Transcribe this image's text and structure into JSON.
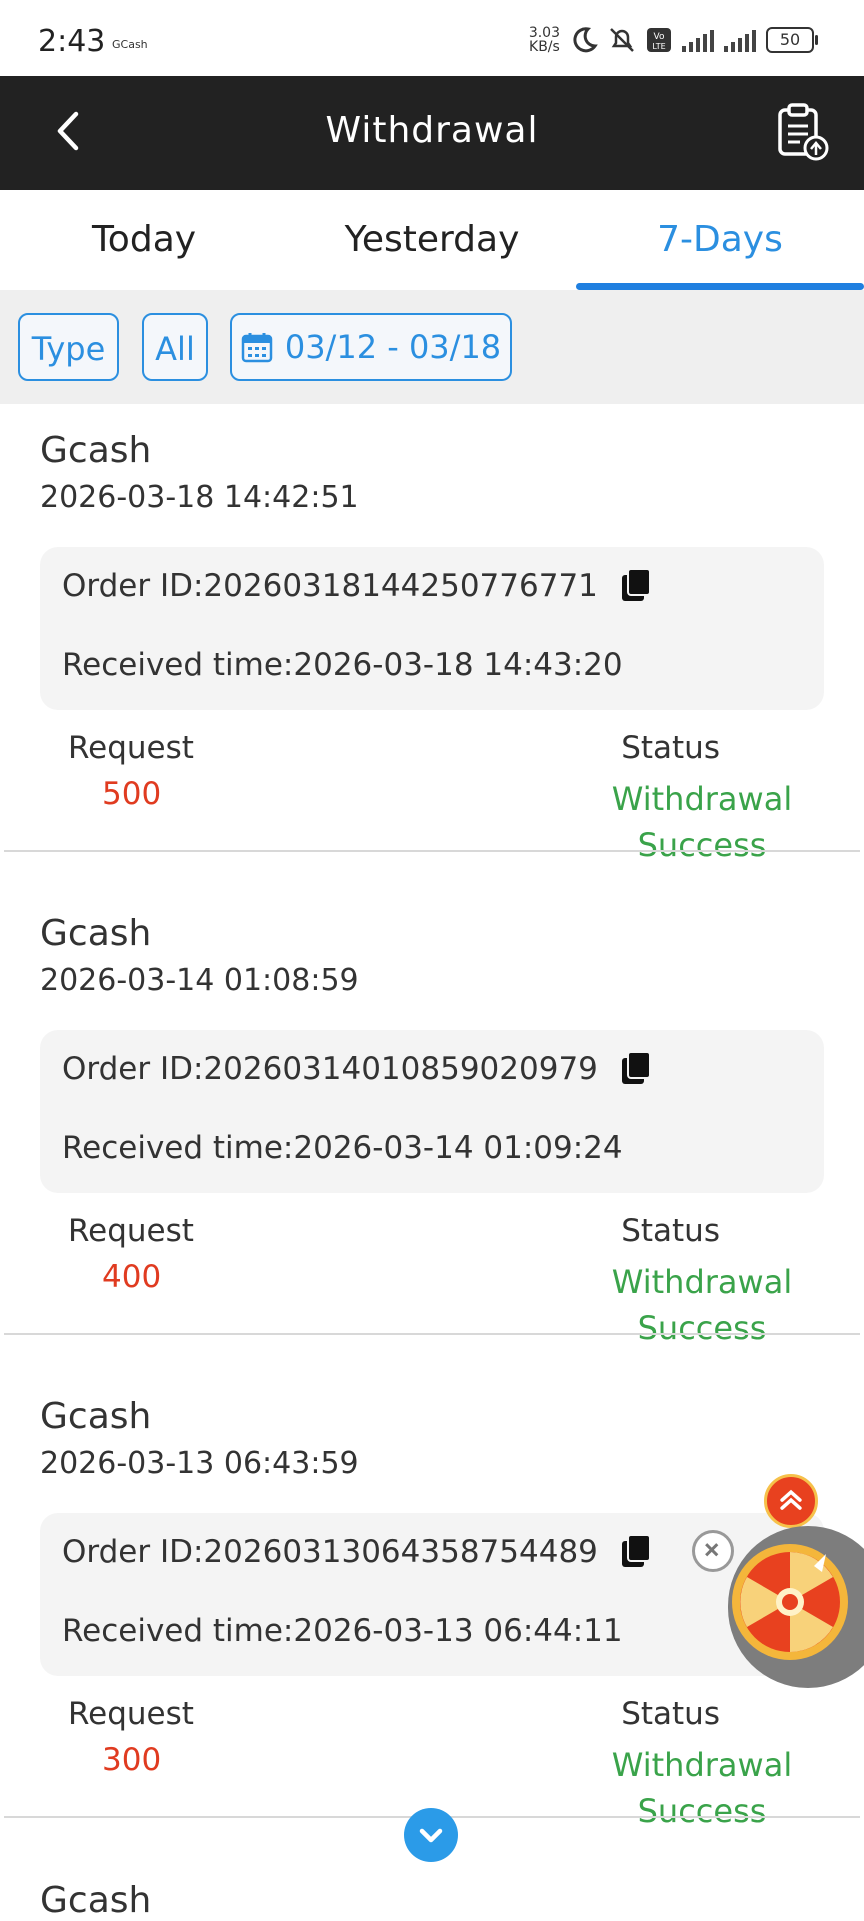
{
  "status_bar": {
    "time": "2:43",
    "app_label": "GCash",
    "net_speed": "3.03",
    "net_unit": "KB/s",
    "network_type": "4G",
    "volte": "Vo LTE",
    "battery": "50"
  },
  "header": {
    "title": "Withdrawal",
    "back_icon": "chevron-left-icon",
    "record_icon": "clipboard-upload-icon"
  },
  "tabs": [
    {
      "label": "Today",
      "active": false
    },
    {
      "label": "Yesterday",
      "active": false
    },
    {
      "label": "7-Days",
      "active": true
    }
  ],
  "filters": {
    "type_label": "Type",
    "all_label": "All",
    "date_range": "03/12 - 03/18"
  },
  "labels": {
    "order_id_prefix": "Order ID:",
    "received_prefix": "Received time:",
    "request": "Request",
    "status": "Status"
  },
  "records": [
    {
      "method": "Gcash",
      "datetime": "2026-03-18 14:42:51",
      "order_id": "20260318144250776771",
      "received_time": "2026-03-18 14:43:20",
      "request": "500",
      "status_line1": "Withdrawal",
      "status_line2": "Success"
    },
    {
      "method": "Gcash",
      "datetime": "2026-03-14 01:08:59",
      "order_id": "20260314010859020979",
      "received_time": "2026-03-14 01:09:24",
      "request": "400",
      "status_line1": "Withdrawal",
      "status_line2": "Success"
    },
    {
      "method": "Gcash",
      "datetime": "2026-03-13 06:43:59",
      "order_id": "20260313064358754489",
      "received_time": "2026-03-13 06:44:11",
      "request": "300",
      "status_line1": "Withdrawal",
      "status_line2": "Success"
    }
  ],
  "partial_record": {
    "method": "Gcash"
  },
  "colors": {
    "accent": "#2b8fe0",
    "header_bg": "#222222",
    "amount": "#e03b20",
    "success": "#3aa34a"
  }
}
